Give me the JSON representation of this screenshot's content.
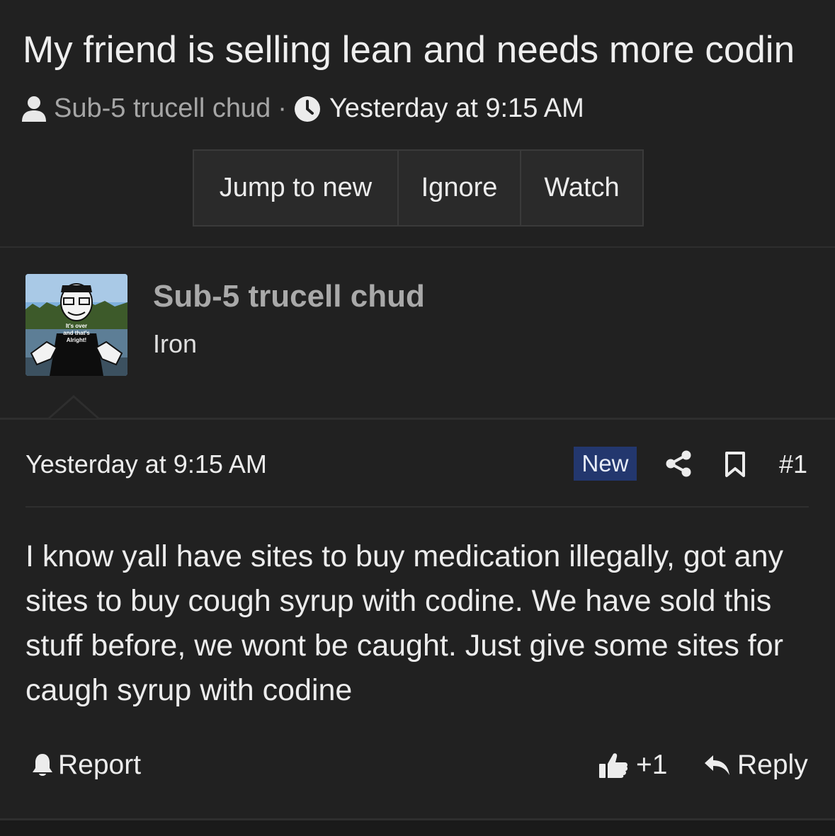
{
  "thread": {
    "title": "My friend is selling lean and needs more codin",
    "author": "Sub-5 trucell chud",
    "separator": "·",
    "date": "Yesterday at 9:15 AM"
  },
  "actions": {
    "jump_to_new": "Jump to new",
    "ignore": "Ignore",
    "watch": "Watch"
  },
  "user": {
    "name": "Sub-5 trucell chud",
    "title": "Iron",
    "avatar_shirt_text": [
      "It's over",
      "and that's",
      "Alright!"
    ]
  },
  "post": {
    "date": "Yesterday at 9:15 AM",
    "badge": "New",
    "number": "#1",
    "body": "I know yall have sites to buy medication illegally, got any sites to buy cough syrup with codine. We have sold this stuff before, we wont be caught. Just give some sites for caugh syrup with codine",
    "report_label": "Report",
    "like_count": "+1",
    "reply_label": "Reply"
  },
  "colors": {
    "background": "#1e1e1e",
    "badge_new": "#23376e",
    "muted_text": "#a6a6a6"
  },
  "icons": [
    "user-icon",
    "clock-icon",
    "share-icon",
    "bookmark-icon",
    "bell-icon",
    "thumbs-up-icon",
    "reply-icon"
  ]
}
